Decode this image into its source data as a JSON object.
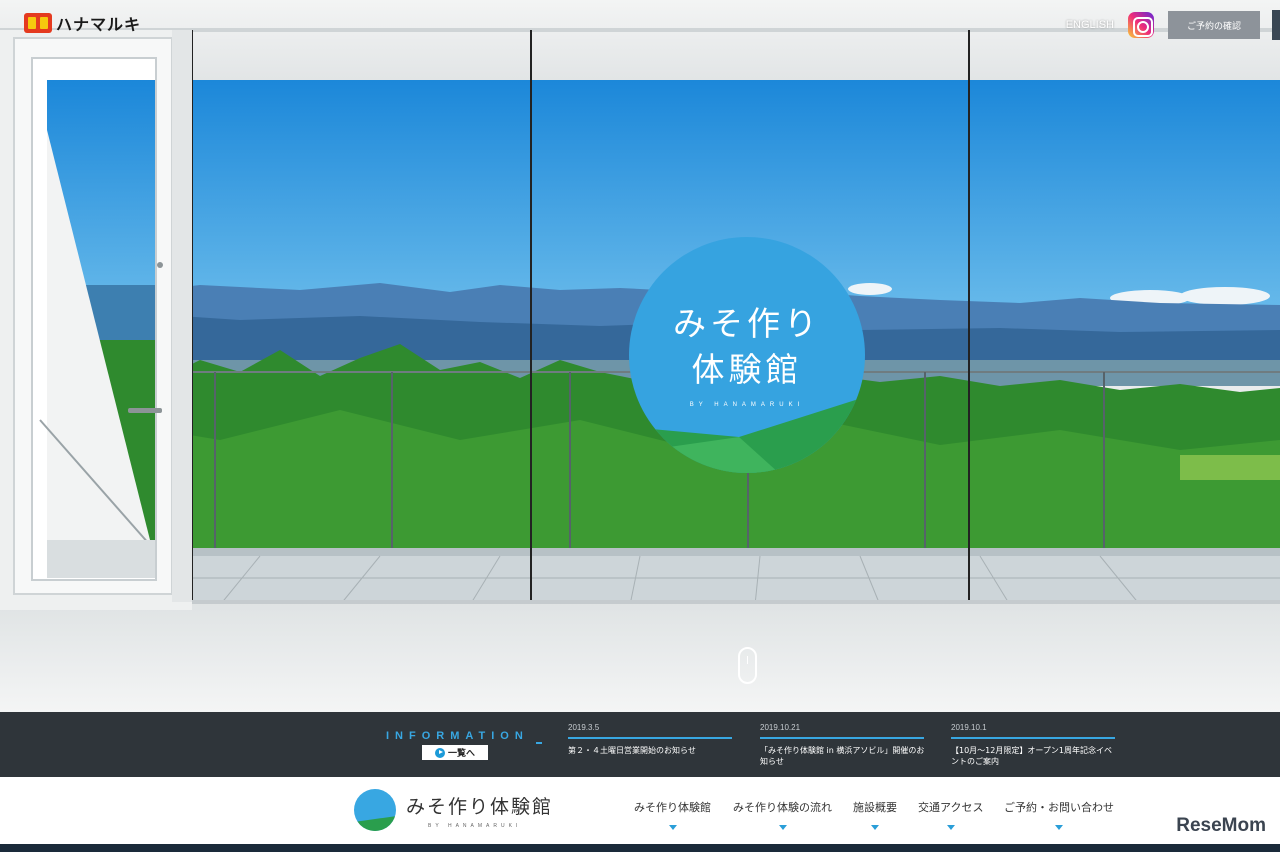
{
  "header": {
    "brand": "ハナマルキ",
    "lang_link": "ENGLISH",
    "instagram_icon": "instagram-icon",
    "reserve_label": "ご予約の確認"
  },
  "hero": {
    "logo_line1": "みそ作り",
    "logo_line2": "体験館",
    "logo_sub": "BY HANAMARUKI"
  },
  "info": {
    "heading": "INFORMATION",
    "list_button": "一覧へ",
    "items": [
      {
        "date": "2019.3.5",
        "title": "第２・４土曜日営業開始のお知らせ"
      },
      {
        "date": "2019.10.21",
        "title": "「みそ作り体験館 in 横浜アソビル」開催のお知らせ"
      },
      {
        "date": "2019.10.1",
        "title": "【10月～12月限定】オープン1周年記念イベントのご案内"
      }
    ]
  },
  "footer_nav": {
    "logo_text": "みそ作り体験館",
    "logo_sub": "BY HANAMARUKI",
    "items": [
      {
        "label": "みそ作り体験館"
      },
      {
        "label": "みそ作り体験の流れ"
      },
      {
        "label": "施設概要"
      },
      {
        "label": "交通アクセス"
      },
      {
        "label": "ご予約・お問い合わせ"
      }
    ]
  },
  "watermark": "ReseMom",
  "colors": {
    "accent": "#38a7e2",
    "info_bg": "#2f353a",
    "green": "#2a9e4d"
  }
}
